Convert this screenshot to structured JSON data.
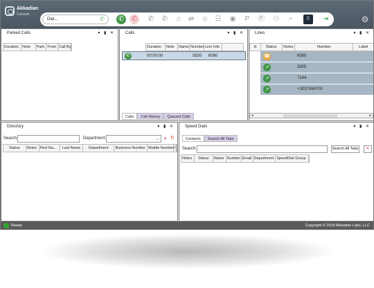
{
  "app": {
    "brand": "Akkadian",
    "sub": "Console"
  },
  "toolbar": {
    "dial_placeholder": "Dial..."
  },
  "panels": {
    "parked": {
      "title": "Parked Calls",
      "headers": [
        "Duration",
        "Note",
        "Park",
        "From",
        "Call By"
      ]
    },
    "calls": {
      "title": "Calls",
      "headers": [
        "Duration",
        "Note",
        "Name",
        "Number",
        "Line Info"
      ],
      "row": {
        "duration": "00:00:00",
        "number": "5920",
        "line_info": "6080"
      },
      "tabs": [
        "Calls",
        "Call History",
        "Queued Calls"
      ]
    },
    "lines": {
      "title": "Lines",
      "headers": [
        "Status",
        "Notes",
        "Number",
        "Label"
      ],
      "rows": [
        "6080",
        "3305",
        "7244",
        "+3037994700"
      ]
    },
    "directory": {
      "title": "Directory",
      "search_label": "Search:",
      "department_label": "Department:",
      "headers": [
        "Status",
        "Notes",
        "First Na...",
        "Last Name",
        "Department",
        "Business Number",
        "Mobile Number",
        "I"
      ]
    },
    "speed": {
      "title": "Speed Dials",
      "tabs": [
        "Contacts",
        "Search All Tabs"
      ],
      "search_label": "Search:",
      "search_button": "Search All Tabs",
      "headers": [
        "Notes",
        "Status",
        "Name",
        "Number",
        "Email",
        "Department",
        "SpeedDial Group"
      ]
    }
  },
  "status": {
    "left": "Ready",
    "right": "Copyright © 2018 Akkadian Labs, LLC"
  }
}
